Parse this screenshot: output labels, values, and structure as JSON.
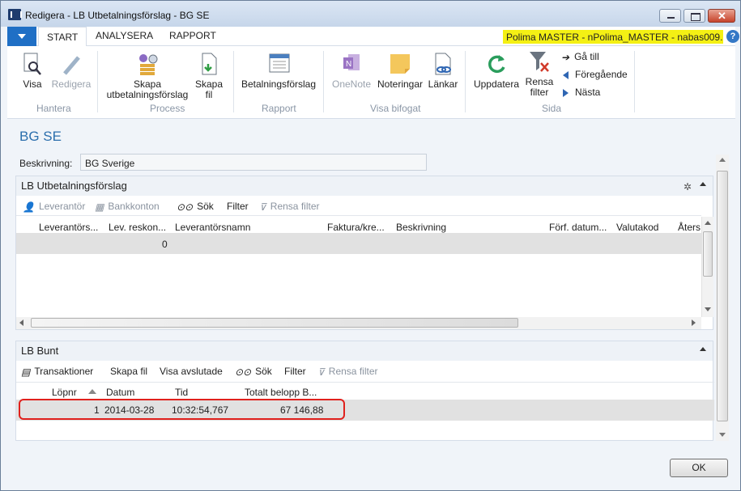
{
  "window": {
    "title": "Redigera - LB Utbetalningsförslag - BG SE"
  },
  "tabs": [
    {
      "label": "START"
    },
    {
      "label": "ANALYSERA"
    },
    {
      "label": "RAPPORT"
    }
  ],
  "company": "Polima MASTER - nPolima_MASTER - nabas009....",
  "ribbon": {
    "visa": "Visa",
    "redigera": "Redigera",
    "skapa1": "Skapa",
    "skapa2": "utbetalningsförslag",
    "skapafil1": "Skapa",
    "skapafil2": "fil",
    "betalningsforslag": "Betalningsförslag",
    "onenote": "OneNote",
    "noteringar": "Noteringar",
    "lankar": "Länkar",
    "uppdatera": "Uppdatera",
    "rensa1": "Rensa",
    "rensa2": "filter",
    "gatill": "Gå till",
    "foregaende": "Föregående",
    "nasta": "Nästa",
    "groups": {
      "hantera": "Hantera",
      "process": "Process",
      "rapport": "Rapport",
      "visabifogat": "Visa bifogat",
      "sida": "Sida"
    }
  },
  "page": {
    "title": "BG SE",
    "desc_label": "Beskrivning:",
    "desc_value": "BG Sverige"
  },
  "part1": {
    "title": "LB Utbetalningsförslag",
    "actions": {
      "leverantor": "Leverantör",
      "bankkonton": "Bankkonton",
      "sok": "Sök",
      "filter": "Filter",
      "rensa": "Rensa filter"
    },
    "columns": [
      "Leverantörs...",
      "Lev. reskon...",
      "Leverantörsnamn",
      "Faktura/kre...",
      "Beskrivning",
      "Förf. datum...",
      "Valutakod",
      "Återst"
    ],
    "row": {
      "lev_reskon": "0"
    }
  },
  "part2": {
    "title": "LB Bunt",
    "actions": {
      "transaktioner": "Transaktioner",
      "skapafil": "Skapa fil",
      "visaavslutade": "Visa avslutade",
      "sok": "Sök",
      "filter": "Filter",
      "rensa": "Rensa filter"
    },
    "columns": [
      "Löpnr",
      "Datum",
      "Tid",
      "Totalt belopp B..."
    ],
    "row": {
      "lopnr": "1",
      "datum": "2014-03-28",
      "tid": "10:32:54,767",
      "belopp": "67 146,88"
    }
  },
  "ok": "OK",
  "colors": {
    "accent": "#1f6fc5",
    "title": "#2c6fad",
    "highlight": "#f4f014",
    "selection": "#e1e1e1",
    "redbox": "#e0211d"
  }
}
